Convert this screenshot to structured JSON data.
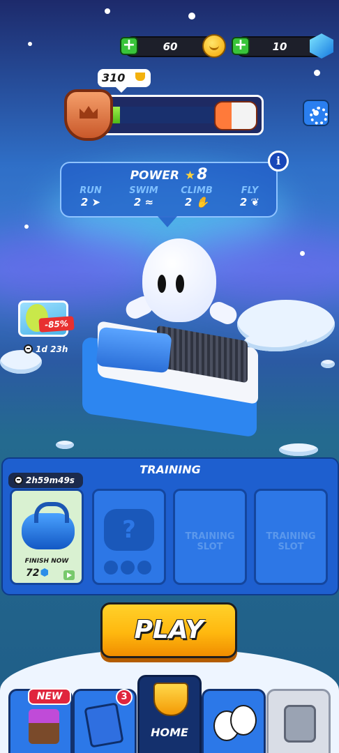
{
  "header": {
    "coins": "60",
    "gems": "10",
    "trophies": "310",
    "trophy_progress_fraction": 0.14
  },
  "power": {
    "title": "POWER",
    "value": "8",
    "stats": [
      {
        "label": "RUN",
        "value": "2"
      },
      {
        "label": "SWIM",
        "value": "2"
      },
      {
        "label": "CLIMB",
        "value": "2"
      },
      {
        "label": "FLY",
        "value": "2"
      }
    ]
  },
  "offer": {
    "discount": "-85%",
    "timer": "1d 23h"
  },
  "training": {
    "title": "TRAINING",
    "timer": "2h59m49s",
    "active_slot": {
      "finish_label": "FINISH NOW",
      "cost": "72"
    },
    "empty_slots": [
      "TRAINING SLOT",
      "TRAINING SLOT"
    ]
  },
  "play": {
    "label": "PLAY"
  },
  "nav": {
    "shop_badge": "NEW",
    "cards_badge": "3",
    "home_label": "HOME"
  },
  "colors": {
    "accent": "#2c78e8",
    "play": "#ffb80f",
    "badge": "#e0253d"
  }
}
